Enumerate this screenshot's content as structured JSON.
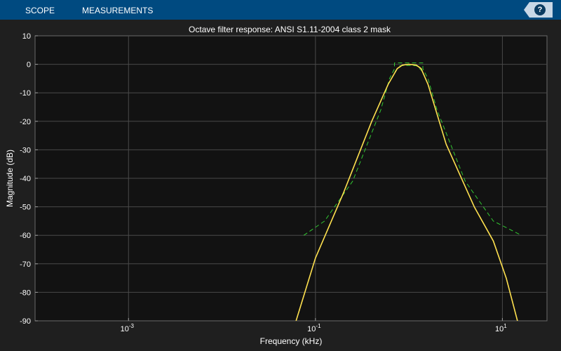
{
  "toolbar": {
    "tabs": [
      "SCOPE",
      "MEASUREMENTS"
    ],
    "help_label": "?"
  },
  "colors": {
    "toolbar_bg": "#004a80",
    "figure_bg": "#1f1f1f",
    "axes_bg": "#121212",
    "grid": "#4a4a4a",
    "response_line": "#ffe14f",
    "mask_line": "#32c832"
  },
  "chart_data": {
    "type": "line",
    "title": "Octave filter response: ANSI S1.11-2004 class 2 mask",
    "xlabel": "Frequency (kHz)",
    "ylabel": "Magnitude (dB)",
    "xscale": "log",
    "xlim": [
      0.0001,
      30
    ],
    "ylim": [
      -90,
      10
    ],
    "xticks": [
      {
        "base": "10",
        "exp": "-3",
        "value": 0.001
      },
      {
        "base": "10",
        "exp": "-1",
        "value": 0.1
      },
      {
        "base": "10",
        "exp": "1",
        "value": 10
      }
    ],
    "yticks": [
      "10",
      "0",
      "-10",
      "-20",
      "-30",
      "-40",
      "-50",
      "-60",
      "-70",
      "-80",
      "-90"
    ],
    "grid": true,
    "series": [
      {
        "style": "solid",
        "color": "#ffe14f",
        "x": [
          0.062,
          0.1,
          0.2,
          0.4,
          0.6,
          0.75,
          0.85,
          1.0,
          1.2,
          1.35,
          1.6,
          2.5,
          5.0,
          8.0,
          11.0,
          14.5
        ],
        "y": [
          -90,
          -68,
          -45,
          -20,
          -7,
          -1.5,
          -0.3,
          0,
          -0.3,
          -1.5,
          -7,
          -28,
          -50,
          -62,
          -75,
          -90
        ]
      },
      {
        "style": "dashed",
        "color": "#32c832",
        "x": [
          0.075,
          0.125,
          0.25,
          0.5,
          0.62,
          0.7,
          0.7,
          1.41,
          1.41,
          1.6,
          2.0,
          4.0,
          8.0,
          16.0
        ],
        "y": [
          -60,
          -55,
          -41,
          -16,
          -5,
          -1.6,
          0.5,
          0.5,
          -1.6,
          -5,
          -16,
          -41,
          -55,
          -60
        ]
      },
      {
        "style": "dashed",
        "color": "#32c832",
        "x": [
          0.71,
          0.8,
          1.0,
          1.2,
          1.4
        ],
        "y": [
          -2.5,
          -0.5,
          -0.4,
          -0.5,
          -2.5
        ]
      }
    ]
  }
}
